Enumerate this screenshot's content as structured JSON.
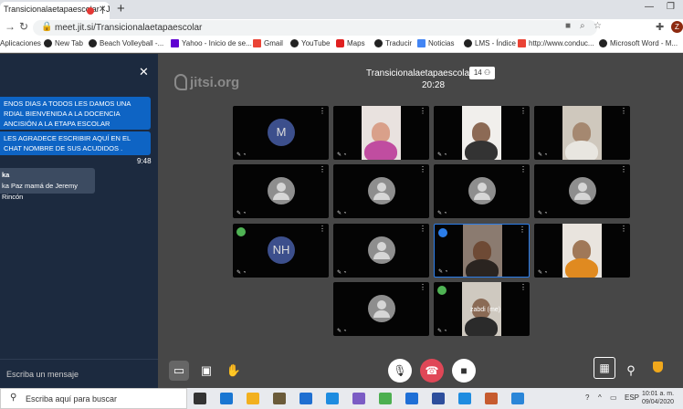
{
  "browser": {
    "tab_title": "Transicionalaetapaescolar | J",
    "tab_close": "✕",
    "new_tab": "+",
    "url": "meet.jit.si/Transicionalaetapaescolar",
    "bookmarks": [
      {
        "label": "Aplicaciones",
        "color": "#4285f4"
      },
      {
        "label": "New Tab",
        "color": "#222222"
      },
      {
        "label": "Beach Volleyball -...",
        "color": "#222222"
      },
      {
        "label": "Yahoo - Inicio de se...",
        "color": "#5f01d1"
      },
      {
        "label": "Gmail",
        "color": "#ea4335"
      },
      {
        "label": "YouTube",
        "color": "#222222"
      },
      {
        "label": "Maps",
        "color": "#e02020"
      },
      {
        "label": "Traducir",
        "color": "#222222"
      },
      {
        "label": "Noticias",
        "color": "#4285f4"
      },
      {
        "label": "LMS - Índice",
        "color": "#222222"
      },
      {
        "label": "http://www.conduc...",
        "color": "#ea4335"
      },
      {
        "label": "Microsoft Word - M...",
        "color": "#222222"
      }
    ],
    "profile_initial": "Z"
  },
  "chat": {
    "messages": [
      {
        "text": "ENOS DIAS A TODOS LES DAMOS UNA RDIAL BIENVENIDA A LA DOCENCIA ANCISIÓN A LA ETAPA ESCOLAR"
      },
      {
        "text": "LES AGRADECE ESCRIBIR AQUÍ EN EL CHAT NOMBRE DE SUS ACUDIDOS ."
      }
    ],
    "timestamp": "9:48",
    "incoming": {
      "sender": "ka",
      "text": "ka Paz mamá de Jeremy Rincón"
    },
    "input_placeholder": "Escriba un mensaje",
    "close_icon": "✕"
  },
  "meeting": {
    "logo": "jitsi.org",
    "title": "Transicionalaetapaescolar",
    "participant_count": "14",
    "timer": "20:28",
    "tiles": [
      {
        "kind": "initials",
        "initials": "M"
      },
      {
        "kind": "video",
        "skin": "#d9a08a",
        "shirt": "#c04da0",
        "bg": "#e9e2df"
      },
      {
        "kind": "video",
        "skin": "#8c6a55",
        "shirt": "#333333",
        "bg": "#f1efec"
      },
      {
        "kind": "video",
        "skin": "#a58870",
        "shirt": "#e8e6e0",
        "bg": "#cfc8bd"
      },
      {
        "kind": "generic"
      },
      {
        "kind": "generic"
      },
      {
        "kind": "generic"
      },
      {
        "kind": "generic"
      },
      {
        "kind": "initials",
        "initials": "NH",
        "audio": "green"
      },
      {
        "kind": "generic"
      },
      {
        "kind": "video",
        "skin": "#6e4a35",
        "shirt": "#2a2420",
        "bg": "#8b7b70",
        "audio": "blue",
        "active": true
      },
      {
        "kind": "video",
        "skin": "#a07858",
        "shirt": "#e08a20",
        "bg": "#e9e4de"
      },
      {
        "kind": "generic"
      },
      {
        "kind": "video",
        "skin": "#8a6a55",
        "shirt": "#2b2b2b",
        "bg": "#cfc9c0",
        "audio": "green",
        "name": "zabdi (me)"
      }
    ],
    "tile_menu_icon": "⋮",
    "tile_status_icon": "✎ ◔"
  },
  "toolbox": {
    "chat_icon": "chat-bubble-icon",
    "share_icon": "screen-share-icon",
    "raise_hand_icon": "raise-hand-icon",
    "mic_icon": "microphone-icon",
    "hangup_icon": "hangup-icon",
    "camera_icon": "camera-icon",
    "tile_view_icon": "tile-view-icon",
    "invite_icon": "invite-icon",
    "security_icon": "shield-icon"
  },
  "taskbar": {
    "search_placeholder": "Escriba aquí para buscar",
    "language": "ESP",
    "time": "10:01 a. m.",
    "date": "09/04/2020",
    "app_colors": [
      "#333333",
      "#1976d2",
      "#f2b01e",
      "#6b5b3a",
      "#1f6fd1",
      "#1e8ce0",
      "#7b5cc4",
      "#4caf50",
      "#1e6fd6",
      "#2d4e9c",
      "#1e8ce0",
      "#c65b2f",
      "#2a86d8"
    ]
  }
}
